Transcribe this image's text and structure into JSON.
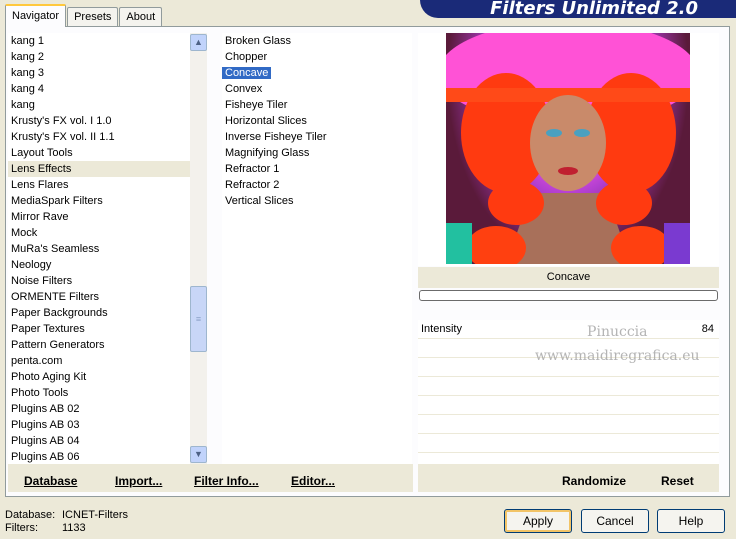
{
  "tabs": [
    "Navigator",
    "Presets",
    "About"
  ],
  "banner_title": "Filters Unlimited 2.0",
  "categories": [
    "kang 1",
    "kang 2",
    "kang 3",
    "kang 4",
    "kang",
    "Krusty's FX vol. I 1.0",
    "Krusty's FX vol. II 1.1",
    "Layout Tools",
    "Lens Effects",
    "Lens Flares",
    "MediaSpark Filters",
    "Mirror Rave",
    "Mock",
    "MuRa's Seamless",
    "Neology",
    "Noise Filters",
    "ORMENTE Filters",
    "Paper Backgrounds",
    "Paper Textures",
    "Pattern Generators",
    "penta.com",
    "Photo Aging Kit",
    "Photo Tools",
    "Plugins AB 02",
    "Plugins AB 03",
    "Plugins AB 04",
    "Plugins AB 06"
  ],
  "selected_category": "Lens Effects",
  "filters": [
    "Broken Glass",
    "Chopper",
    "Concave",
    "Convex",
    "Fisheye Tiler",
    "Horizontal Slices",
    "Inverse Fisheye Tiler",
    "Magnifying Glass",
    "Refractor 1",
    "Refractor 2",
    "Vertical Slices"
  ],
  "selected_filter": "Concave",
  "preview": {
    "filter_name": "Concave"
  },
  "controls": [
    {
      "label": "Intensity",
      "value": "84"
    }
  ],
  "watermark": {
    "line1": "Pinuccia",
    "line2": "www.maidiregrafica.eu"
  },
  "bottom_links": {
    "database": "Database",
    "import": "Import...",
    "filter_info": "Filter Info...",
    "editor": "Editor...",
    "randomize": "Randomize",
    "reset": "Reset"
  },
  "status": {
    "database_label": "Database:",
    "database_value": "ICNET-Filters",
    "filters_label": "Filters:",
    "filters_value": "1133"
  },
  "buttons": {
    "apply": "Apply",
    "cancel": "Cancel",
    "help": "Help"
  },
  "icons": {
    "scroll_up": "chevron-up-icon",
    "scroll_down": "chevron-down-icon"
  },
  "colors": {
    "banner": "#1a2a78",
    "selection": "#316ac5",
    "default_button_glow": "#f2c467"
  }
}
